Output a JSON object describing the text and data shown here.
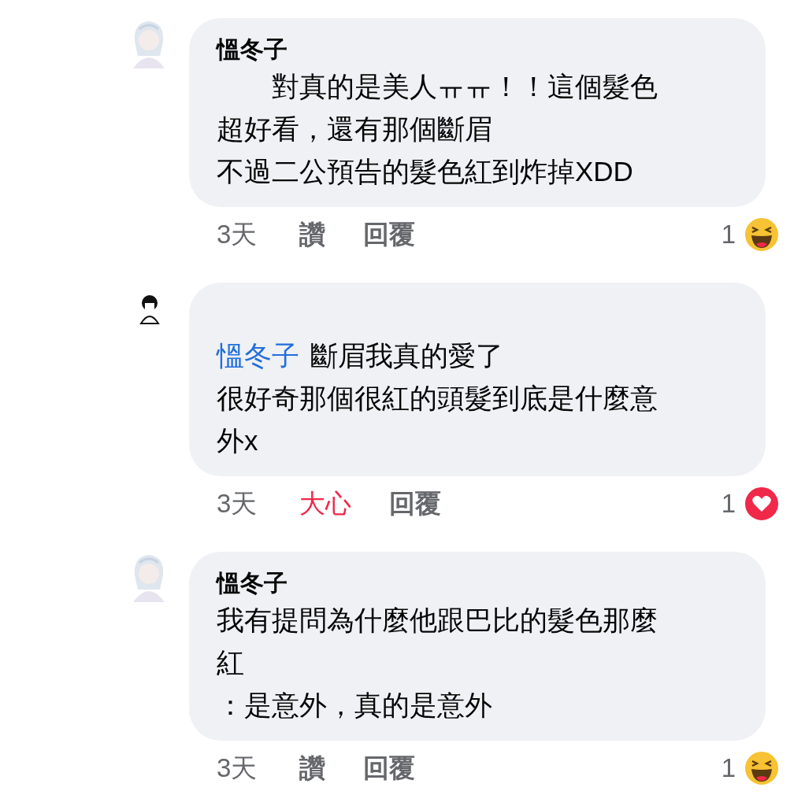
{
  "comments": [
    {
      "avatar": {
        "kind": "illustration"
      },
      "author": "慍冬子",
      "lines": [
        "　　對真的是美人ㅠㅠ！！這個髮色",
        "超好看，還有那個斷眉",
        "不過二公預告的髮色紅到炸掉XDD"
      ],
      "time": "3天",
      "reaction_label": "讚",
      "reacted": false,
      "reply": "回覆",
      "reaction": {
        "count": "1",
        "kind": "haha"
      }
    },
    {
      "avatar": {
        "kind": "sketch"
      },
      "mention": "慍冬子",
      "lines": [
        "斷眉我真的愛了",
        "很好奇那個很紅的頭髮到底是什麼意",
        "外x"
      ],
      "time": "3天",
      "reaction_label": "大心",
      "reacted": true,
      "reply": "回覆",
      "reaction": {
        "count": "1",
        "kind": "love"
      }
    },
    {
      "avatar": {
        "kind": "illustration"
      },
      "author": "慍冬子",
      "lines": [
        "我有提問為什麼他跟巴比的髮色那麼",
        "紅",
        "：是意外，真的是意外"
      ],
      "time": "3天",
      "reaction_label": "讚",
      "reacted": false,
      "reply": "回覆",
      "reaction": {
        "count": "1",
        "kind": "haha"
      }
    }
  ]
}
